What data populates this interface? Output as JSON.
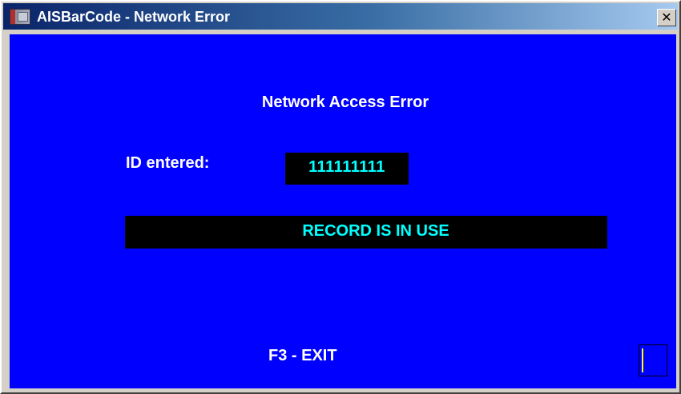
{
  "window": {
    "title": "AISBarCode - Network Error",
    "app_icon": "app-icon",
    "close_glyph": "✕"
  },
  "content": {
    "heading": "Network Access Error",
    "id_label": "ID entered:",
    "id_value": "111111111",
    "status_message": "RECORD IS IN USE",
    "exit_label": "F3 - EXIT",
    "input_value": ""
  },
  "colors": {
    "background": "#0000ff",
    "label_text": "#ffffff",
    "value_text": "#00ffff",
    "value_background": "#000000",
    "caret": "#ffff00"
  }
}
